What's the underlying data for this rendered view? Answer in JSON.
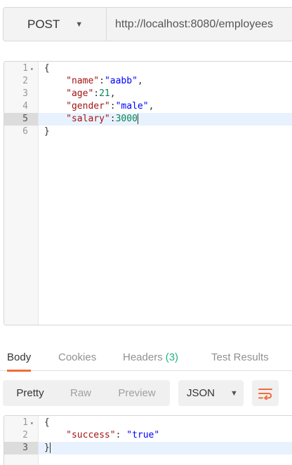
{
  "request": {
    "method": "POST",
    "url": "http://localhost:8080/employees"
  },
  "request_body": {
    "lines": [
      {
        "n": "1",
        "fold": true
      },
      {
        "n": "2"
      },
      {
        "n": "3"
      },
      {
        "n": "4"
      },
      {
        "n": "5"
      },
      {
        "n": "6"
      }
    ],
    "brace_open": "{",
    "brace_close": "}",
    "fields": {
      "name_key": "\"name\"",
      "name_val": "\"aabb\"",
      "age_key": "\"age\"",
      "age_val": "21",
      "gender_key": "\"gender\"",
      "gender_val": "\"male\"",
      "salary_key": "\"salary\"",
      "salary_val": "3000"
    }
  },
  "response_tabs": {
    "body": "Body",
    "cookies": "Cookies",
    "headers": "Headers",
    "headers_count": "(3)",
    "test_results": "Test Results"
  },
  "response_toolbar": {
    "pretty": "Pretty",
    "raw": "Raw",
    "preview": "Preview",
    "format": "JSON"
  },
  "response_body": {
    "brace_open": "{",
    "brace_close": "}",
    "success_key": "\"success\"",
    "success_val": "\"true\""
  },
  "icons": {
    "method_caret": "▼",
    "format_caret": "▼",
    "fold_marker": "▾",
    "wrap": "wrap-lines-icon"
  },
  "colors": {
    "accent": "#f26b3a",
    "count_green": "#26b47f"
  }
}
